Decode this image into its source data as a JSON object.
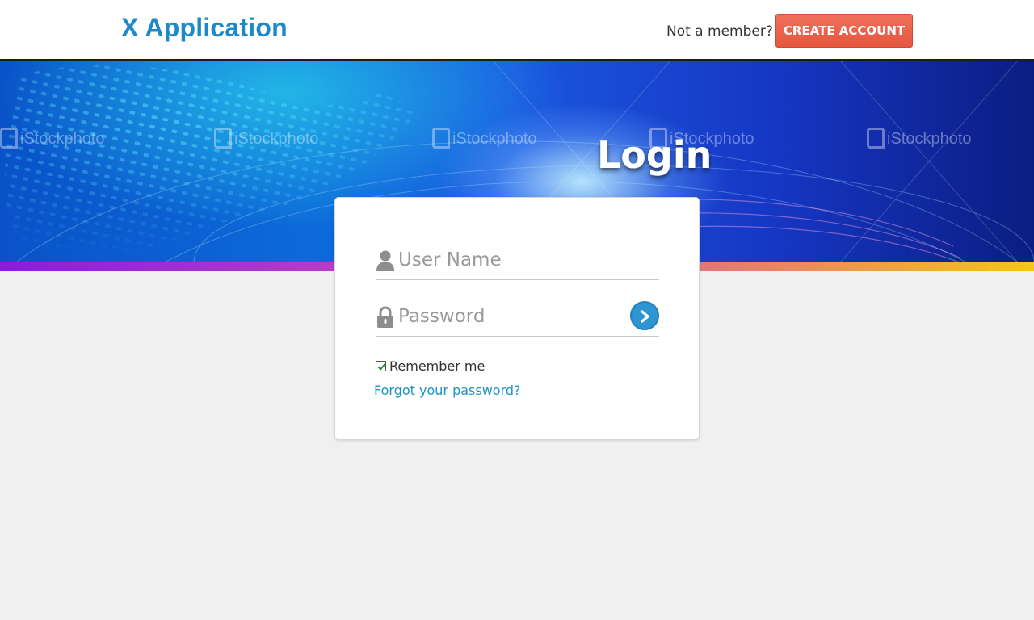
{
  "header": {
    "app_title": "X Application",
    "member_prompt": "Not a member?",
    "create_account_label": "CREATE ACCOUNT",
    "brand_color": "#1c8ac9",
    "cta_color": "#e6563f"
  },
  "banner": {
    "heading": "Login",
    "watermark_text": "iStockphoto"
  },
  "login_form": {
    "username_placeholder": "User Name",
    "username_icon": "user-icon",
    "password_placeholder": "Password",
    "password_icon": "lock-icon",
    "submit_icon": "chevron-right-icon",
    "remember_label": "Remember me",
    "remember_checked": true,
    "forgot_link": "Forgot your password?",
    "link_color": "#1a93c7",
    "submit_color": "#2e95d3"
  }
}
